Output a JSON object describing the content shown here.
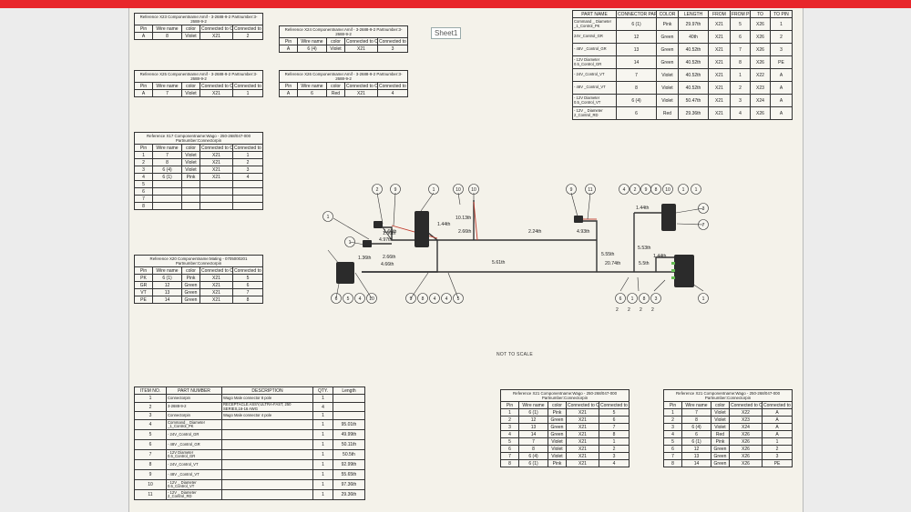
{
  "sheet_tab": "Sheet1",
  "not_to_scale": "NOT TO SCALE",
  "col_headers": {
    "pin": "Pin",
    "wire": "Wire name",
    "color": "color",
    "conn": "Connected to Connector",
    "cpin": "Connected to Pin"
  },
  "conn_tables": [
    {
      "caption": "Reference X23 Componentname:Amif - 3-2688-9-2 Partnumber:3-2688-9-2",
      "rows": [
        [
          "A",
          "8",
          "Violet",
          "X21",
          "2"
        ]
      ]
    },
    {
      "caption": "Reference X24 Componentname:Amif - 3-2688-9-2 Partnumber:3-2688-9-2",
      "rows": [
        [
          "A",
          "6 (4)",
          "Violet",
          "X21",
          "3"
        ]
      ]
    },
    {
      "caption": "Reference X25 Componentname:Amif - 3-2688-9-2 Partnumber:3-2688-9-2",
      "rows": [
        [
          "A",
          "7",
          "Violet",
          "X21",
          "1"
        ]
      ]
    },
    {
      "caption": "Reference X26 Componentname:Amif - 3-2688-9-2 Partnumber:3-2688-9-2",
      "rows": [
        [
          "A",
          "6",
          "Red",
          "X21",
          "4"
        ]
      ]
    },
    {
      "caption": "Reference X17 Componentname:Wago - 250-268/047-000 Partnumber:Connectorpin",
      "rows": [
        [
          "1",
          "7",
          "Violet",
          "X21",
          "1"
        ],
        [
          "2",
          "8",
          "Violet",
          "X21",
          "2"
        ],
        [
          "3",
          "6 (4)",
          "Violet",
          "X21",
          "3"
        ],
        [
          "4",
          "6 (1)",
          "Pink",
          "X21",
          "4"
        ],
        [
          "5",
          "",
          "",
          "",
          ""
        ],
        [
          "6",
          "",
          "",
          "",
          ""
        ],
        [
          "7",
          "",
          "",
          "",
          ""
        ],
        [
          "8",
          "",
          "",
          "",
          ""
        ]
      ]
    },
    {
      "caption": "Reference X20 Componentname:Mating - 0705000201 Partnumber:Connectorpin",
      "rows": [
        [
          "PK",
          "6 (1)",
          "Pink",
          "X21",
          "5"
        ],
        [
          "GR",
          "12",
          "Green",
          "X21",
          "6"
        ],
        [
          "VT",
          "13",
          "Green",
          "X21",
          "7"
        ],
        [
          "PE",
          "14",
          "Green",
          "X21",
          "8"
        ]
      ]
    },
    {
      "caption": "Reference X21 Componentname:Wago - 250-268/047-000 Partnumber:Connectorpin",
      "rows": [
        [
          "1",
          "6 (1)",
          "Pink",
          "X21",
          "5"
        ],
        [
          "2",
          "12",
          "Green",
          "X21",
          "6"
        ],
        [
          "3",
          "13",
          "Green",
          "X21",
          "7"
        ],
        [
          "4",
          "14",
          "Green",
          "X21",
          "8"
        ],
        [
          "5",
          "7",
          "Violet",
          "X21",
          "1"
        ],
        [
          "6",
          "8",
          "Violet",
          "X21",
          "2"
        ],
        [
          "7",
          "6 (4)",
          "Violet",
          "X21",
          "3"
        ],
        [
          "8",
          "6 (1)",
          "Pink",
          "X21",
          "4"
        ]
      ]
    },
    {
      "caption": "Reference X21 Componentname:Wago - 250-268/047-000 Partnumber:Connectorpin",
      "rows": [
        [
          "1",
          "7",
          "Violet",
          "X22",
          "A"
        ],
        [
          "2",
          "8",
          "Violet",
          "X23",
          "A"
        ],
        [
          "3",
          "6 (4)",
          "Violet",
          "X24",
          "A"
        ],
        [
          "4",
          "6",
          "Red",
          "X26",
          "A"
        ],
        [
          "5",
          "6 (1)",
          "Pink",
          "X26",
          "1"
        ],
        [
          "6",
          "12",
          "Green",
          "X26",
          "2"
        ],
        [
          "7",
          "13",
          "Green",
          "X26",
          "3"
        ],
        [
          "8",
          "14",
          "Green",
          "X26",
          "PE"
        ]
      ]
    }
  ],
  "wire_list": {
    "headers": [
      "PART NAME",
      "CONNECTOR PART ID",
      "COLOR",
      "LENGTH",
      "FROM",
      "FROM PIN",
      "TO",
      "TO PIN"
    ],
    "rows": [
      [
        "Command _ Diameter _1_Control_PK",
        "6 (1)",
        "Pink",
        "29.97th",
        "X21",
        "5",
        "X26",
        "1"
      ],
      [
        "24V_Control_GR",
        "12",
        "Green",
        "40th",
        "X21",
        "6",
        "X26",
        "2"
      ],
      [
        "- 48V _Control_GR",
        "13",
        "Green",
        "40.52th",
        "X21",
        "7",
        "X26",
        "3"
      ],
      [
        "- 12V Diameter 0.5_Control_GR",
        "14",
        "Green",
        "40.52th",
        "X21",
        "8",
        "X26",
        "PE"
      ],
      [
        "- 24V_Control_VT",
        "7",
        "Violet",
        "40.52th",
        "X21",
        "1",
        "X22",
        "A"
      ],
      [
        "- 48V _Control_VT",
        "8",
        "Violet",
        "40.52th",
        "X21",
        "2",
        "X23",
        "A"
      ],
      [
        "- 12V Diameter 0.5_Control_VT",
        "6 (4)",
        "Violet",
        "50.47th",
        "X21",
        "3",
        "X24",
        "A"
      ],
      [
        "- 12V _ Diameter 2_Control_RD",
        "6",
        "Red",
        "29.36th",
        "X21",
        "4",
        "X26",
        "A"
      ]
    ]
  },
  "bom": {
    "headers": [
      "ITEM NO.",
      "PART NUMBER",
      "DESCRIPTION",
      "QTY.",
      "Length"
    ],
    "rows": [
      [
        "1",
        "Connectorpin",
        "Wago Male connector 8 pole",
        "1",
        ""
      ],
      [
        "2",
        "3-2688-9-2",
        "RECEPTACLE ASSY,ULTRA-FAST, 250 SERIES,16-16 AWG",
        "4",
        ""
      ],
      [
        "3",
        "Connectorpin",
        "Wago Male connector 4 pole",
        "1",
        ""
      ],
      [
        "4",
        "Command _ Diameter _1_Control_PK",
        "",
        "1",
        "95.01th"
      ],
      [
        "5",
        "- 24V_Control_GR",
        "",
        "1",
        "49.99th"
      ],
      [
        "6",
        "- 48V _Control_GR",
        "",
        "1",
        "50.11th"
      ],
      [
        "7",
        "- 12V Diameter 0.5_Control_GR",
        "",
        "1",
        "50.5th"
      ],
      [
        "8",
        "- 24V_Control_VT",
        "",
        "1",
        "92.99th"
      ],
      [
        "9",
        "- 48V _Control_VT",
        "",
        "1",
        "55.65th"
      ],
      [
        "10",
        "- 12V _ Diameter 0.5_Control_VT",
        "",
        "1",
        "97.36th"
      ],
      [
        "11",
        "- 12V _ Diameter 2_Control_RD",
        "",
        "1",
        "29.36th"
      ]
    ]
  },
  "diagram": {
    "dims": [
      "1.66th",
      "1.44th",
      "10.13th",
      "2.66th",
      "2.24th",
      "4.93th",
      "5.55th",
      "5.53th",
      "1.44th",
      "5.61th",
      "20.74th",
      "5.5th",
      "1.44th",
      "2.66th",
      "1.56th",
      "4.97th",
      "1.36th",
      "4.66th"
    ],
    "balloons": [
      "2",
      "9",
      "1",
      "10",
      "10",
      "9",
      "11",
      "4",
      "2",
      "9",
      "8",
      "10",
      "1",
      "1",
      "3",
      "7",
      "6",
      "5",
      "4",
      "10",
      "9",
      "8",
      "4",
      "4",
      "5",
      "6",
      "1",
      "8",
      "3",
      "1",
      "1",
      "1"
    ],
    "subnumbers": [
      "2",
      "2",
      "2",
      "2"
    ]
  }
}
